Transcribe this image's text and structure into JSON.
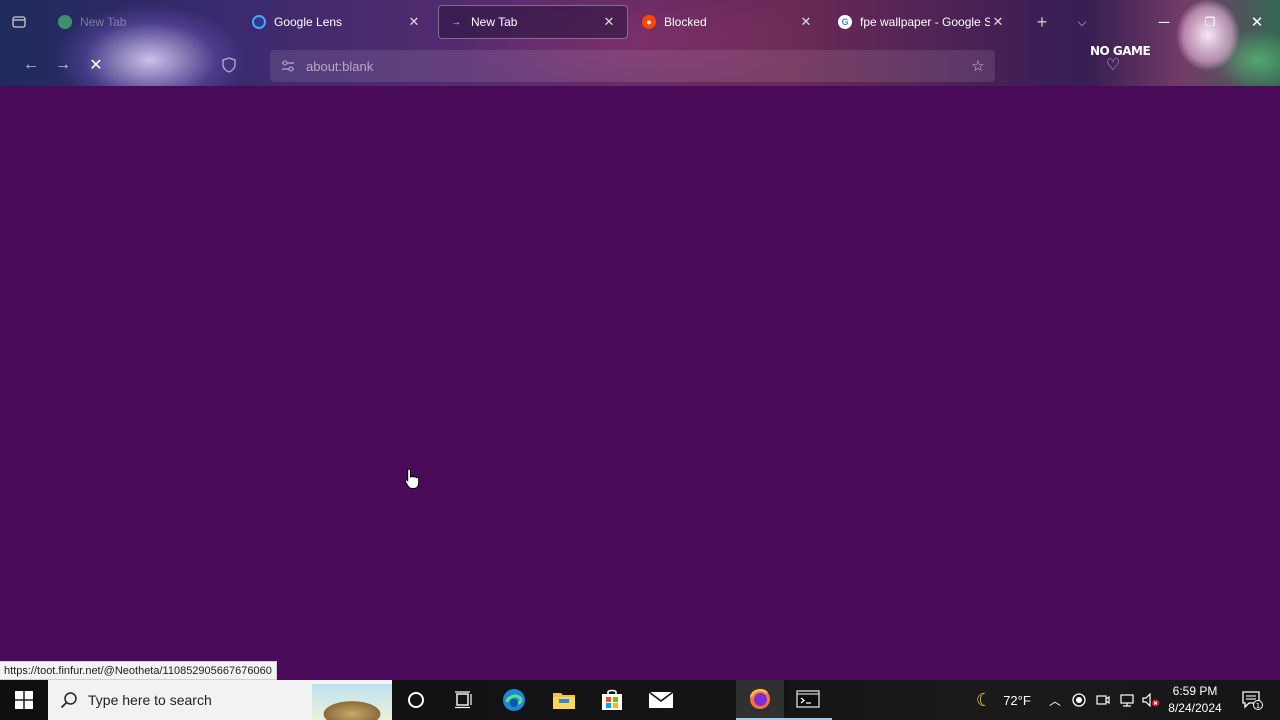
{
  "browser": {
    "tabs": [
      {
        "label": "New Tab",
        "state": "faded",
        "favicon": "new-tab-icon"
      },
      {
        "label": "Google Lens",
        "state": "normal",
        "favicon": "google-lens-icon"
      },
      {
        "label": "New Tab",
        "state": "active",
        "favicon": "new-tab-icon"
      },
      {
        "label": "Blocked",
        "state": "normal",
        "favicon": "reddit-icon"
      },
      {
        "label": "fpe wallpaper - Google Sc",
        "state": "normal",
        "favicon": "google-icon"
      }
    ],
    "address_bar": {
      "value": "about:blank"
    },
    "theme_logo": "NO GAME"
  },
  "status_link": "https://toot.finfur.net/@Neotheta/110852905667676060",
  "taskbar": {
    "search_placeholder": "Type here to search",
    "weather": "72°F",
    "time": "6:59 PM",
    "date": "8/24/2024",
    "notification_count": "1"
  },
  "colors": {
    "page_background": "#4a0a5a",
    "taskbar": "#141414",
    "active_indicator": "#9ccbf0"
  }
}
